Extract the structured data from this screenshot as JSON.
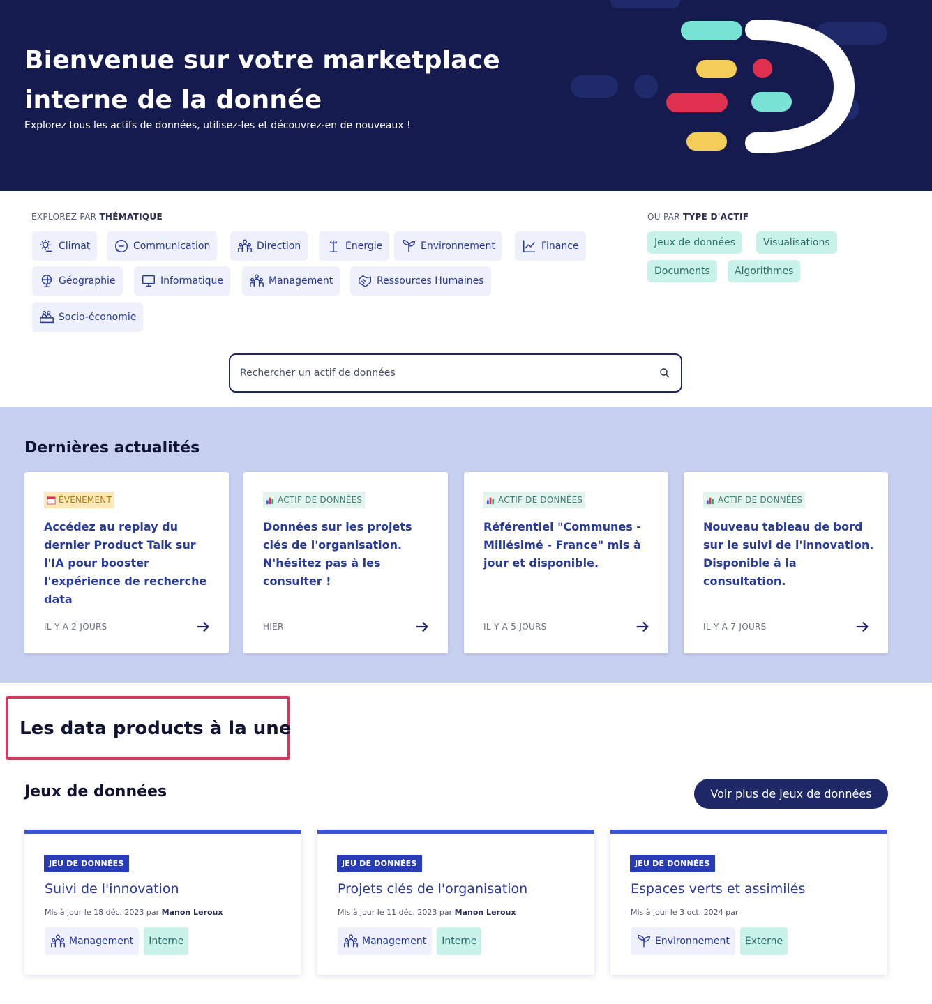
{
  "hero": {
    "title": "Bienvenue sur votre marketplace interne de la donnée",
    "subtitle": "Explorez tous les actifs de données, utilisez-les et découvrez-en de nouveaux !"
  },
  "themes": {
    "label_prefix": "EXPLOREZ PAR ",
    "label_bold": "THÉMATIQUE",
    "items": [
      {
        "label": "Climat",
        "icon": "sun-cloud-icon"
      },
      {
        "label": "Communication",
        "icon": "chat-bubble-icon"
      },
      {
        "label": "Direction",
        "icon": "people-group-icon"
      },
      {
        "label": "Energie",
        "icon": "power-line-icon"
      },
      {
        "label": "Environnement",
        "icon": "sprout-icon"
      },
      {
        "label": "Finance",
        "icon": "line-chart-icon"
      },
      {
        "label": "Géographie",
        "icon": "globe-icon"
      },
      {
        "label": "Informatique",
        "icon": "monitor-icon"
      },
      {
        "label": "Management",
        "icon": "people-group-icon"
      },
      {
        "label": "Ressources Humaines",
        "icon": "handshake-icon"
      },
      {
        "label": "Socio-économie",
        "icon": "people-hand-icon"
      }
    ]
  },
  "asset_types": {
    "label_prefix": "OU PAR ",
    "label_bold": "TYPE D'ACTIF",
    "items": [
      "Jeux de données",
      "Visualisations",
      "Documents",
      "Algorithmes"
    ]
  },
  "search": {
    "placeholder": "Rechercher un actif de données"
  },
  "news": {
    "title": "Dernières actualités",
    "cards": [
      {
        "tag": "ÉVÉNEMENT",
        "text": "Accédez au replay du dernier Product Talk sur l'IA pour booster l'expérience de recherche data",
        "date": "IL Y A 2 JOURS"
      },
      {
        "tag": "ACTIF DE DONNÉES",
        "text": "Données sur les projets clés de l'organisation. N'hésitez pas à les consulter !",
        "date": "HIER"
      },
      {
        "tag": "ACTIF DE DONNÉES",
        "text": "Référentiel \"Communes - Millésimé - France\" mis à jour et disponible.",
        "date": "IL Y A 5 JOURS"
      },
      {
        "tag": "ACTIF DE DONNÉES",
        "text": "Nouveau tableau de bord sur le suivi de l'innovation. Disponible à la consultation.",
        "date": "IL Y A 7 JOURS"
      }
    ]
  },
  "featured": {
    "title": "Les data products à la une",
    "section_title": "Jeux de données",
    "more_button": "Voir plus de jeux de données",
    "cards": [
      {
        "badge": "JEU DE DONNÉES",
        "title": "Suivi de l'innovation",
        "meta": "Mis à jour le 18 déc. 2023 par ",
        "author": "Manon Leroux",
        "theme": "Management",
        "type": "Interne"
      },
      {
        "badge": "JEU DE DONNÉES",
        "title": "Projets clés de l'organisation",
        "meta": "Mis à jour le 11 déc. 2023 par ",
        "author": "Manon Leroux",
        "theme": "Management",
        "type": "Interne"
      },
      {
        "badge": "JEU DE DONNÉES",
        "title": "Espaces verts et assimilés",
        "meta": "Mis à jour le 3 oct. 2024 par",
        "author": "",
        "theme": "Environnement",
        "type": "Externe"
      }
    ]
  },
  "colors": {
    "hero_bg": "#151b4f",
    "news_bg": "#c8d0f2",
    "accent": "#3b55d6",
    "highlight_border": "#d7365f"
  }
}
